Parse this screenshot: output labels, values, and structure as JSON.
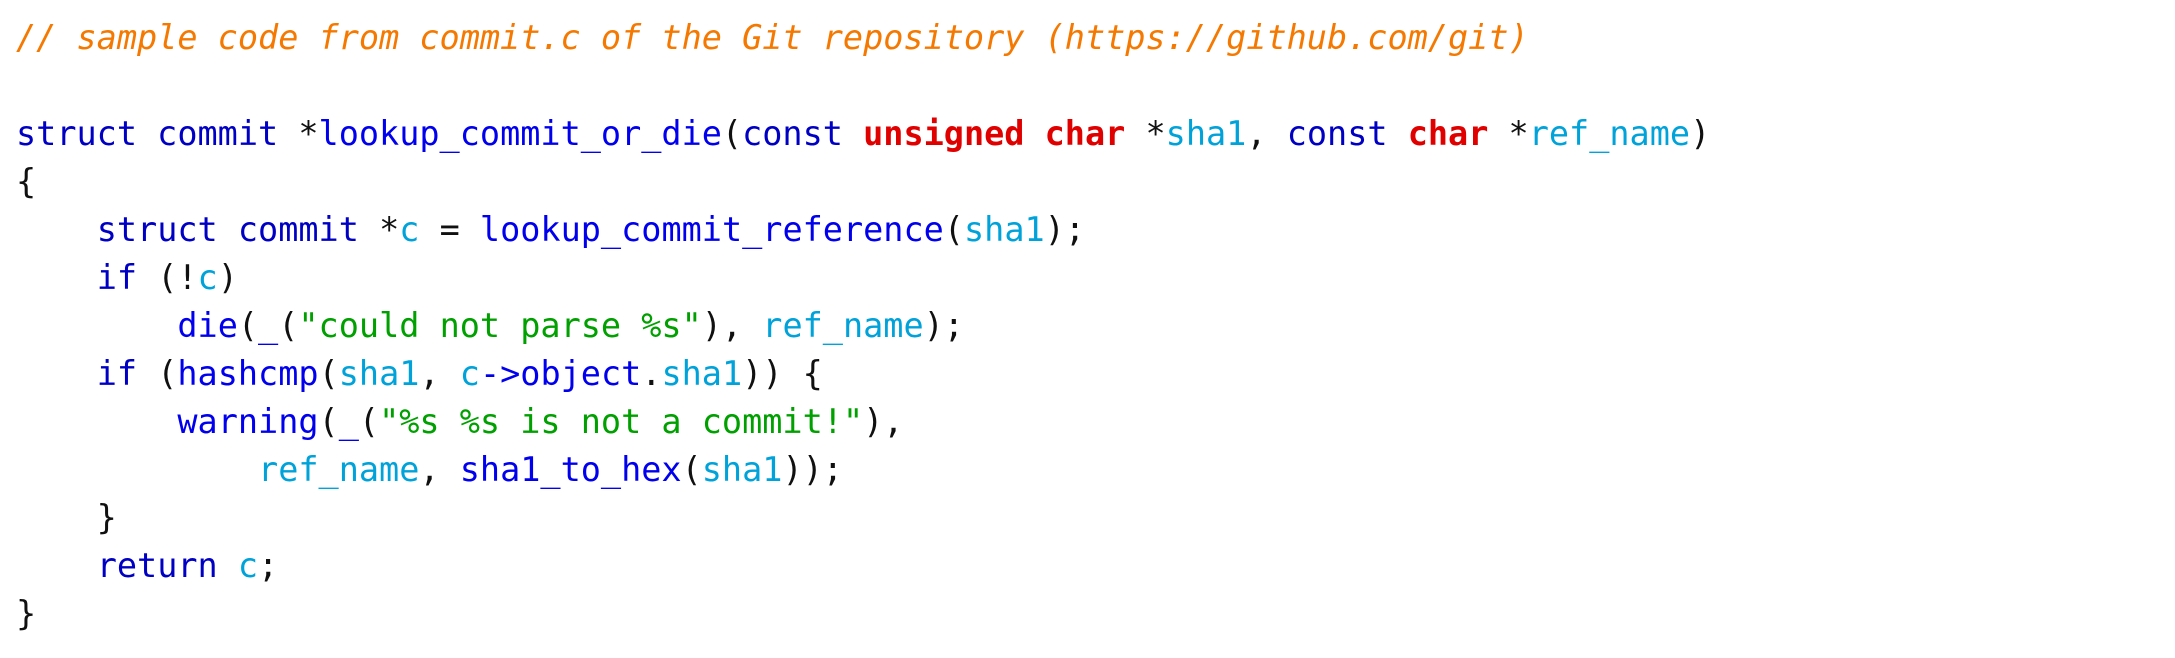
{
  "code": {
    "language": "c",
    "source_file": "commit.c",
    "palette": {
      "background": "#ffffff",
      "plain": "#101010",
      "comment": "#f57900",
      "keyword": "#0000c4",
      "type": "#e00000",
      "function": "#0000ee",
      "variable": "#00a2da",
      "string": "#00a000"
    },
    "lines": [
      {
        "index": 0,
        "text": "// sample code from commit.c of the Git repository (https://github.com/git)",
        "tokens": [
          {
            "t": "// sample code from commit.c of the Git repository (https://github.com/git)",
            "c": "comment"
          }
        ]
      },
      {
        "index": 1,
        "text": "",
        "tokens": []
      },
      {
        "index": 2,
        "text": "struct commit *lookup_commit_or_die(const unsigned char *sha1, const char *ref_name)",
        "tokens": [
          {
            "t": "struct commit ",
            "c": "keyword"
          },
          {
            "t": "*",
            "c": "plain"
          },
          {
            "t": "lookup_commit_or_die",
            "c": "function"
          },
          {
            "t": "(",
            "c": "plain"
          },
          {
            "t": "const ",
            "c": "keyword"
          },
          {
            "t": "unsigned char ",
            "c": "type"
          },
          {
            "t": "*",
            "c": "plain"
          },
          {
            "t": "sha1",
            "c": "variable"
          },
          {
            "t": ", ",
            "c": "plain"
          },
          {
            "t": "const ",
            "c": "keyword"
          },
          {
            "t": "char ",
            "c": "type"
          },
          {
            "t": "*",
            "c": "plain"
          },
          {
            "t": "ref_name",
            "c": "variable"
          },
          {
            "t": ")",
            "c": "plain"
          }
        ]
      },
      {
        "index": 3,
        "text": "{",
        "tokens": [
          {
            "t": "{",
            "c": "plain"
          }
        ]
      },
      {
        "index": 4,
        "text": "    struct commit *c = lookup_commit_reference(sha1);",
        "tokens": [
          {
            "t": "    ",
            "c": "plain"
          },
          {
            "t": "struct commit ",
            "c": "keyword"
          },
          {
            "t": "*",
            "c": "plain"
          },
          {
            "t": "c",
            "c": "variable"
          },
          {
            "t": " = ",
            "c": "plain"
          },
          {
            "t": "lookup_commit_reference",
            "c": "function"
          },
          {
            "t": "(",
            "c": "plain"
          },
          {
            "t": "sha1",
            "c": "variable"
          },
          {
            "t": ");",
            "c": "plain"
          }
        ]
      },
      {
        "index": 5,
        "text": "    if (!c)",
        "tokens": [
          {
            "t": "    ",
            "c": "plain"
          },
          {
            "t": "if",
            "c": "keyword"
          },
          {
            "t": " (!",
            "c": "plain"
          },
          {
            "t": "c",
            "c": "variable"
          },
          {
            "t": ")",
            "c": "plain"
          }
        ]
      },
      {
        "index": 6,
        "text": "        die(_(\"could not parse %s\"), ref_name);",
        "tokens": [
          {
            "t": "        ",
            "c": "plain"
          },
          {
            "t": "die",
            "c": "function"
          },
          {
            "t": "(",
            "c": "plain"
          },
          {
            "t": "_",
            "c": "function"
          },
          {
            "t": "(",
            "c": "plain"
          },
          {
            "t": "\"could not parse %s\"",
            "c": "string"
          },
          {
            "t": "), ",
            "c": "plain"
          },
          {
            "t": "ref_name",
            "c": "variable"
          },
          {
            "t": ");",
            "c": "plain"
          }
        ]
      },
      {
        "index": 7,
        "text": "    if (hashcmp(sha1, c->object.sha1)) {",
        "tokens": [
          {
            "t": "    ",
            "c": "plain"
          },
          {
            "t": "if",
            "c": "keyword"
          },
          {
            "t": " (",
            "c": "plain"
          },
          {
            "t": "hashcmp",
            "c": "function"
          },
          {
            "t": "(",
            "c": "plain"
          },
          {
            "t": "sha1",
            "c": "variable"
          },
          {
            "t": ", ",
            "c": "plain"
          },
          {
            "t": "c",
            "c": "variable"
          },
          {
            "t": "->object",
            "c": "function"
          },
          {
            "t": ".",
            "c": "plain"
          },
          {
            "t": "sha1",
            "c": "variable"
          },
          {
            "t": ")) {",
            "c": "plain"
          }
        ]
      },
      {
        "index": 8,
        "text": "        warning(_(\"%s %s is not a commit!\"),",
        "tokens": [
          {
            "t": "        ",
            "c": "plain"
          },
          {
            "t": "warning",
            "c": "function"
          },
          {
            "t": "(",
            "c": "plain"
          },
          {
            "t": "_",
            "c": "function"
          },
          {
            "t": "(",
            "c": "plain"
          },
          {
            "t": "\"%s %s is not a commit!\"",
            "c": "string"
          },
          {
            "t": "),",
            "c": "plain"
          }
        ]
      },
      {
        "index": 9,
        "text": "            ref_name, sha1_to_hex(sha1));",
        "tokens": [
          {
            "t": "            ",
            "c": "plain"
          },
          {
            "t": "ref_name",
            "c": "variable"
          },
          {
            "t": ", ",
            "c": "plain"
          },
          {
            "t": "sha1_to_hex",
            "c": "function"
          },
          {
            "t": "(",
            "c": "plain"
          },
          {
            "t": "sha1",
            "c": "variable"
          },
          {
            "t": "));",
            "c": "plain"
          }
        ]
      },
      {
        "index": 10,
        "text": "    }",
        "tokens": [
          {
            "t": "    }",
            "c": "plain"
          }
        ]
      },
      {
        "index": 11,
        "text": "    return c;",
        "tokens": [
          {
            "t": "    ",
            "c": "plain"
          },
          {
            "t": "return",
            "c": "keyword"
          },
          {
            "t": " ",
            "c": "plain"
          },
          {
            "t": "c",
            "c": "variable"
          },
          {
            "t": ";",
            "c": "plain"
          }
        ]
      },
      {
        "index": 12,
        "text": "}",
        "tokens": [
          {
            "t": "}",
            "c": "plain"
          }
        ]
      }
    ]
  }
}
